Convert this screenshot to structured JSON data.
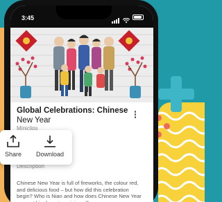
{
  "status_bar": {
    "time": "3:45"
  },
  "video": {
    "title": "Global Celebrations: Chinese",
    "subtitle": "New Year",
    "author": "Miniclips"
  },
  "share_menu": {
    "share_label": "Share",
    "download_label": "Download"
  },
  "description": {
    "label": "Description",
    "text": "Chinese New Year is full of fireworks, the colour red, and delicious food – but how did this celebration begin? Who is Nian and how does Chinese New Year prevent him from terrorising villages once mo..."
  },
  "colors": {
    "background": "#1f9aa6",
    "accent_yellow": "#f7d23a",
    "accent_blue": "#3fb6c8",
    "accent_coral": "#f06a5a"
  }
}
